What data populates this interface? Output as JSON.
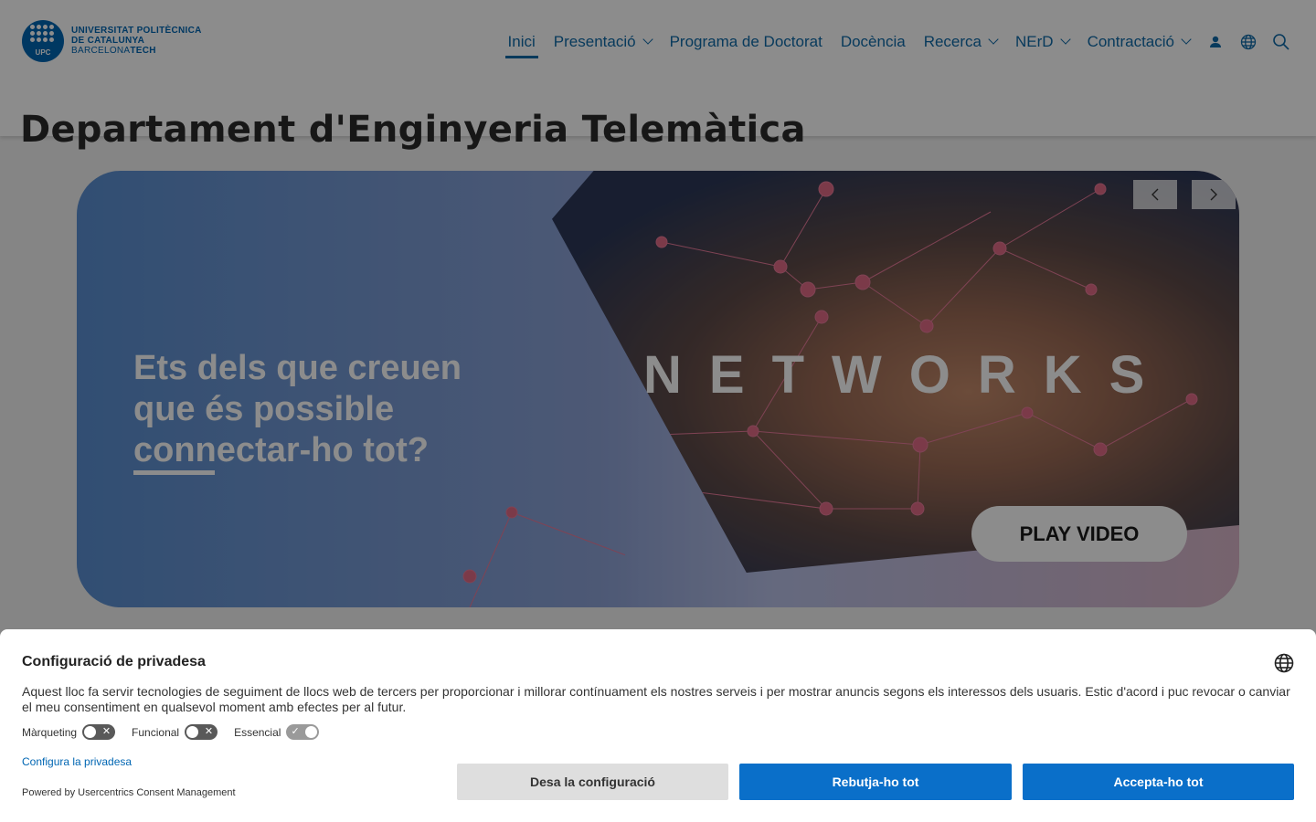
{
  "logo": {
    "upc": "UPC",
    "line1": "UNIVERSITAT POLITÈCNICA",
    "line2": "DE CATALUNYA",
    "line3a": "BARCELONA",
    "line3b": "TECH"
  },
  "nav": {
    "items": [
      {
        "label": "Inici"
      },
      {
        "label": "Presentació"
      },
      {
        "label": "Programa de Doctorat"
      },
      {
        "label": "Docència"
      },
      {
        "label": "Recerca"
      },
      {
        "label": "NErD"
      },
      {
        "label": "Contractació"
      }
    ],
    "icons": [
      "user-icon",
      "globe-icon",
      "search-icon"
    ]
  },
  "page": {
    "title_regular": "Departament d'",
    "title_bold": "Enginyeria Telemàtica"
  },
  "hero": {
    "heading": "Ets dels que creuen que és possible connectar-ho tot?",
    "overlay_word": "NETWORKS",
    "play_label": "PLAY VIDEO"
  },
  "consent": {
    "title": "Configuració de privadesa",
    "text": "Aquest lloc fa servir tecnologies de seguiment de llocs web de tercers per proporcionar i millorar contínuament els nostres serveis i per mostrar anuncis segons els interessos dels usuaris. Estic d'acord i puc revocar o canviar el meu consentiment en qualsevol moment amb efectes per al futur.",
    "toggles": [
      {
        "label": "Màrqueting",
        "on": false
      },
      {
        "label": "Funcional",
        "on": false
      },
      {
        "label": "Essencial",
        "on": true
      }
    ],
    "configure_link": "Configura la privadesa",
    "powered_by": "Powered by Usercentrics Consent Management",
    "buttons": {
      "save": "Desa la configuració",
      "reject": "Rebutja-ho tot",
      "accept": "Accepta-ho tot"
    }
  },
  "colors": {
    "brand": "#0066b3",
    "nav_text": "#0f6aa8",
    "button_blue": "#0a6fc9"
  }
}
